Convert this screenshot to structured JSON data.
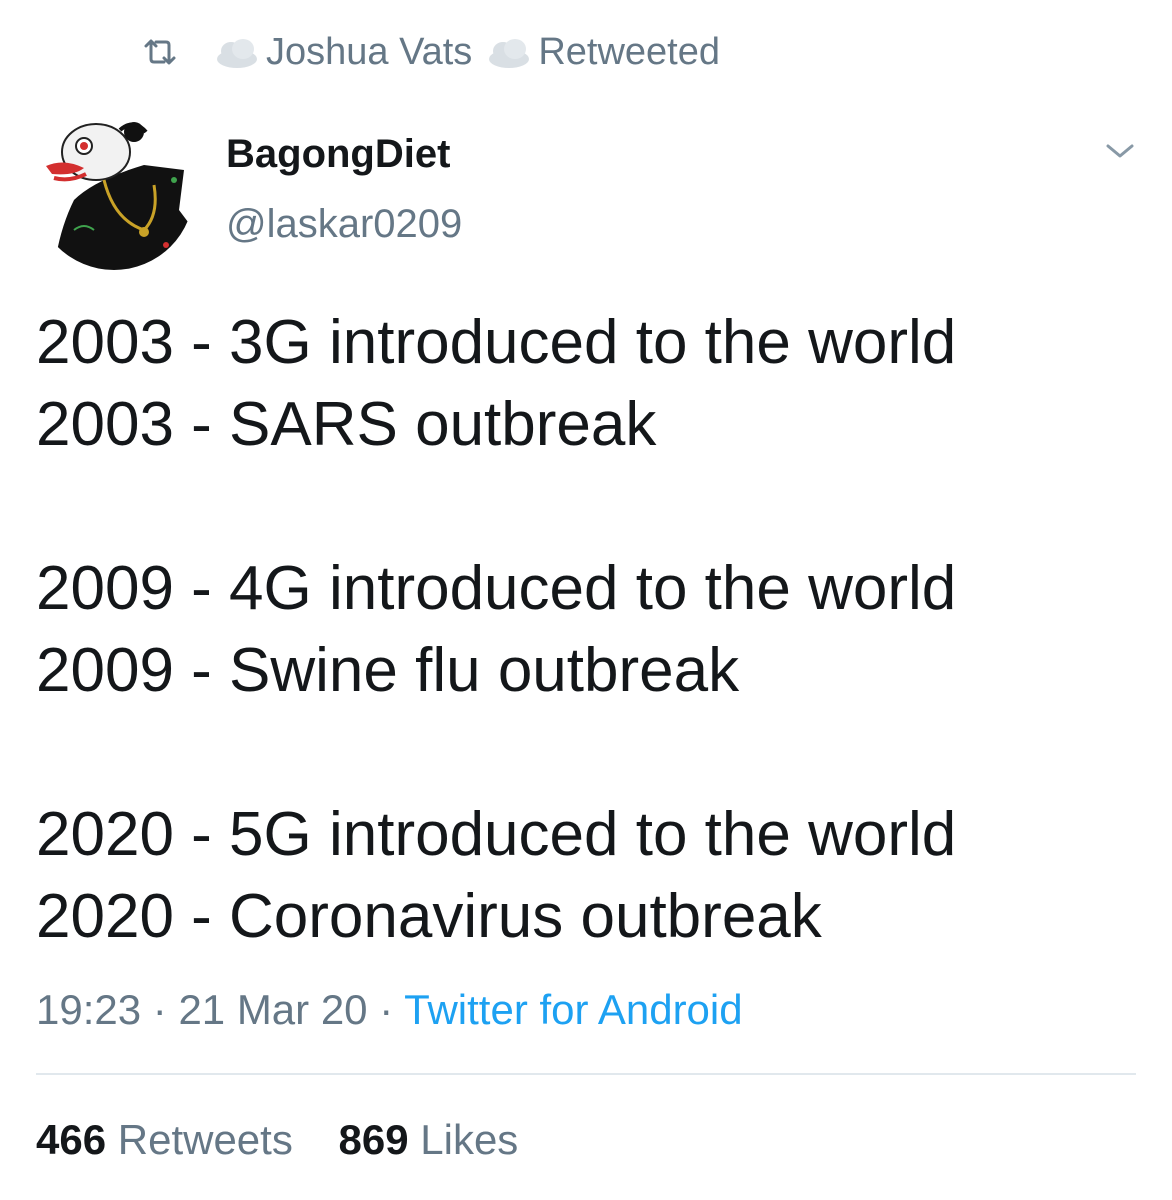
{
  "retweet": {
    "icon": "retweet-icon",
    "retweeter_name": "Joshua Vats",
    "label": "Retweeted"
  },
  "author": {
    "display_name": "BagongDiet",
    "handle": "@laskar0209",
    "avatar_icon": "wayang-avatar"
  },
  "tweet": {
    "lines": [
      "2003 - 3G introduced to the world",
      "2003 - SARS outbreak",
      "",
      "2009 - 4G introduced to the world",
      "2009 - Swine flu outbreak",
      "",
      "2020 - 5G introduced to the world",
      "2020 - Coronavirus outbreak"
    ]
  },
  "meta": {
    "time": "19:23",
    "separator": " · ",
    "date": "21 Mar 20",
    "source": "Twitter for Android"
  },
  "stats": {
    "retweets_count": "466",
    "retweets_label": "Retweets",
    "likes_count": "869",
    "likes_label": "Likes"
  },
  "colors": {
    "text": "#14171a",
    "muted": "#657786",
    "link": "#1da1f2",
    "divider": "#e1e8ed"
  }
}
